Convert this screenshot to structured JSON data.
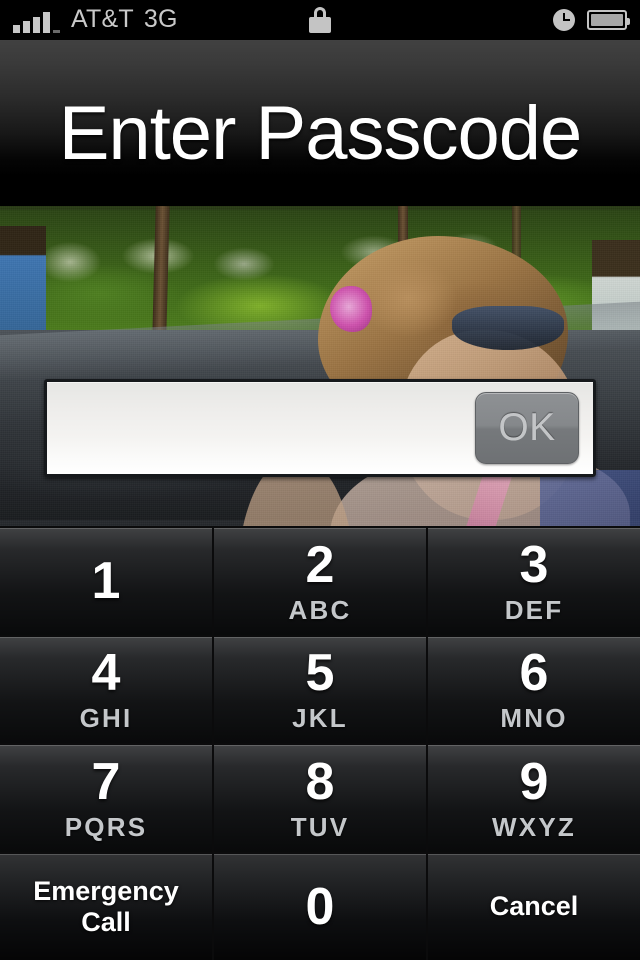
{
  "statusbar": {
    "carrier": "AT&T",
    "network": "3G",
    "signal_bars": 4,
    "signal_total": 5,
    "lock_icon": "lock-icon",
    "clock_icon": "clock-icon",
    "battery_icon": "battery-icon",
    "battery_full": true
  },
  "header": {
    "title": "Enter Passcode"
  },
  "passcode_field": {
    "value": "",
    "placeholder": "",
    "ok_label": "OK"
  },
  "keypad": {
    "keys": [
      {
        "num": "1",
        "letters": ""
      },
      {
        "num": "2",
        "letters": "ABC"
      },
      {
        "num": "3",
        "letters": "DEF"
      },
      {
        "num": "4",
        "letters": "GHI"
      },
      {
        "num": "5",
        "letters": "JKL"
      },
      {
        "num": "6",
        "letters": "MNO"
      },
      {
        "num": "7",
        "letters": "PQRS"
      },
      {
        "num": "8",
        "letters": "TUV"
      },
      {
        "num": "9",
        "letters": "WXYZ"
      },
      {
        "num": "0",
        "letters": ""
      }
    ],
    "emergency_label_line1": "Emergency",
    "emergency_label_line2": "Call",
    "zero_label": "0",
    "cancel_label": "Cancel"
  },
  "colors": {
    "status_text": "#c9c9c9",
    "title_text": "#ffffff",
    "key_number": "#ffffff",
    "key_letters": "#c4c7ca",
    "ok_text": "#c3c5c7",
    "background": "#000000"
  }
}
